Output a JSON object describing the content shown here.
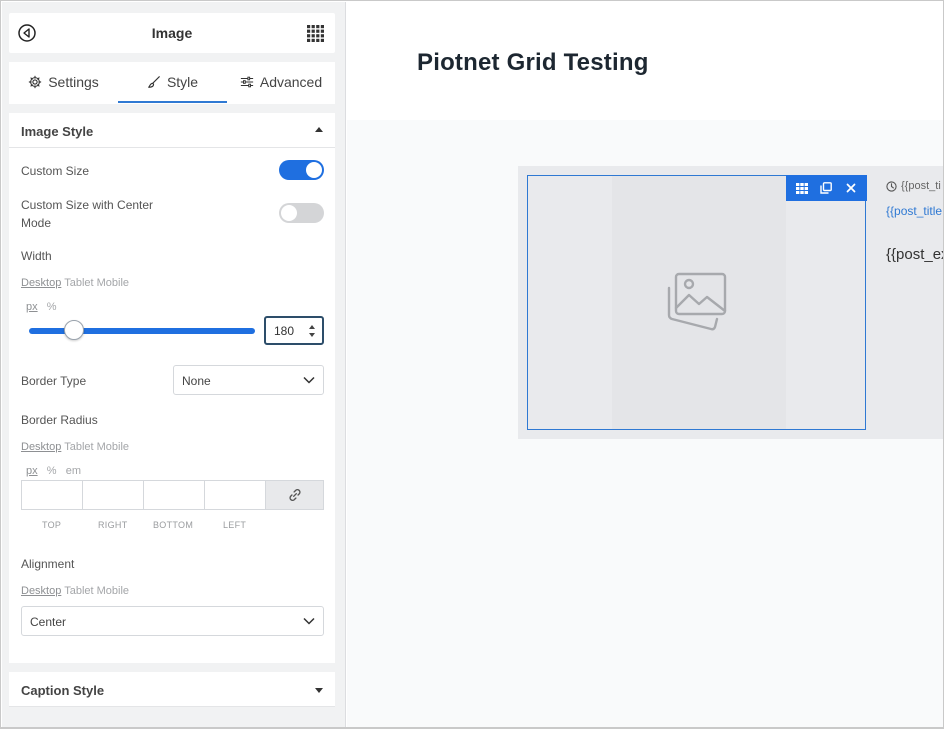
{
  "sidebar": {
    "title": "Image",
    "tabs": [
      {
        "label": "Settings",
        "icon": "gear-icon"
      },
      {
        "label": "Style",
        "icon": "brush-icon",
        "active": true
      },
      {
        "label": "Advanced",
        "icon": "sliders-icon"
      }
    ],
    "image_style": {
      "heading": "Image Style",
      "custom_size": {
        "label": "Custom Size",
        "on": true
      },
      "custom_size_center": {
        "label_line1": "Custom Size with Center",
        "label_line2": "Mode",
        "on": false
      },
      "width": {
        "label": "Width",
        "devices": {
          "desktop": "Desktop",
          "tablet": "Tablet",
          "mobile": "Mobile"
        },
        "units": {
          "px": "px",
          "percent": "%"
        },
        "value": "180",
        "slider_fraction": 0.2
      },
      "border_type": {
        "label": "Border Type",
        "value": "None"
      },
      "border_radius": {
        "label": "Border Radius",
        "devices": {
          "desktop": "Desktop",
          "tablet": "Tablet",
          "mobile": "Mobile"
        },
        "units": {
          "px": "px",
          "percent": "%",
          "em": "em"
        },
        "sides": {
          "top": "TOP",
          "right": "RIGHT",
          "bottom": "BOTTOM",
          "left": "LEFT"
        }
      },
      "alignment": {
        "label": "Alignment",
        "devices": {
          "desktop": "Desktop",
          "tablet": "Tablet",
          "mobile": "Mobile"
        },
        "value": "Center"
      }
    },
    "caption_style": {
      "heading": "Caption Style"
    }
  },
  "canvas": {
    "page_title": "Piotnet Grid Testing",
    "meta_text": "{{post_ti",
    "title_link": "{{post_title",
    "excerpt": "{{post_ex"
  },
  "colors": {
    "accent": "#1f6fe0",
    "link": "#2f79d3",
    "title": "#1d2731"
  }
}
